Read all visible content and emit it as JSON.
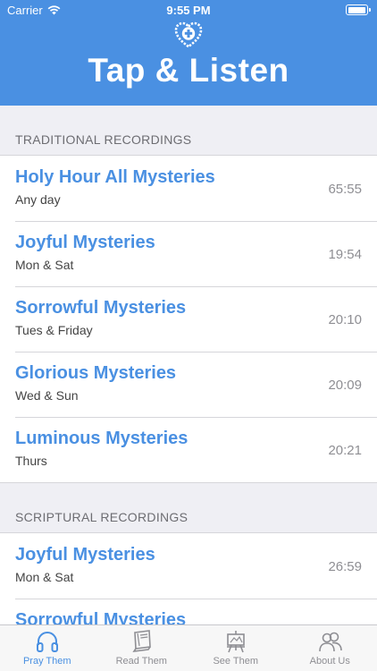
{
  "status_bar": {
    "carrier": "Carrier",
    "time": "9:55 PM",
    "battery_level": 1.0
  },
  "header": {
    "title": "Tap & Listen",
    "logo_icon": "heart-cross-logo-icon"
  },
  "colors": {
    "accent": "#4a90e2",
    "background": "#efeff4",
    "secondary_text": "#8e8e93"
  },
  "sections": [
    {
      "title": "TRADITIONAL RECORDINGS",
      "rows": [
        {
          "title": "Holy Hour All Mysteries",
          "subtitle": "Any day",
          "duration": "65:55"
        },
        {
          "title": "Joyful Mysteries",
          "subtitle": "Mon & Sat",
          "duration": "19:54"
        },
        {
          "title": "Sorrowful Mysteries",
          "subtitle": "Tues & Friday",
          "duration": "20:10"
        },
        {
          "title": "Glorious Mysteries",
          "subtitle": "Wed & Sun",
          "duration": "20:09"
        },
        {
          "title": "Luminous Mysteries",
          "subtitle": "Thurs",
          "duration": "20:21"
        }
      ]
    },
    {
      "title": "SCRIPTURAL RECORDINGS",
      "rows": [
        {
          "title": "Joyful Mysteries",
          "subtitle": "Mon & Sat",
          "duration": "26:59"
        },
        {
          "title": "Sorrowful Mysteries",
          "subtitle": "",
          "duration": ""
        }
      ]
    }
  ],
  "tabs": [
    {
      "label": "Pray Them",
      "icon": "headphones-icon",
      "active": true
    },
    {
      "label": "Read Them",
      "icon": "book-icon",
      "active": false
    },
    {
      "label": "See Them",
      "icon": "easel-icon",
      "active": false
    },
    {
      "label": "About Us",
      "icon": "people-icon",
      "active": false
    }
  ]
}
